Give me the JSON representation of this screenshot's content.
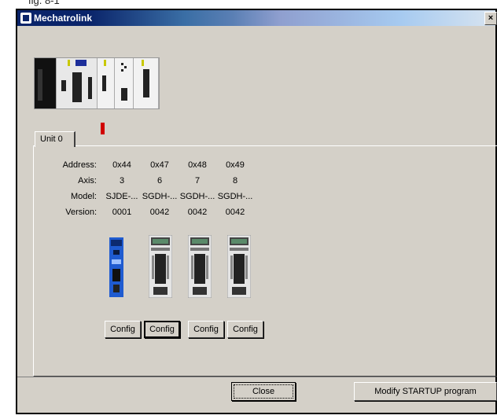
{
  "caption": "fig. 8-1",
  "window": {
    "title": "Mechatrolink",
    "close_glyph": "×"
  },
  "tab": {
    "label": "Unit 0"
  },
  "row_labels": {
    "address": "Address:",
    "axis": "Axis:",
    "model": "Model:",
    "version": "Version:"
  },
  "devices": [
    {
      "address": "0x44",
      "axis": "3",
      "model": "SJDE-...",
      "version": "0001",
      "config_label": "Config"
    },
    {
      "address": "0x47",
      "axis": "6",
      "model": "SGDH-...",
      "version": "0042",
      "config_label": "Config"
    },
    {
      "address": "0x48",
      "axis": "7",
      "model": "SGDH-...",
      "version": "0042",
      "config_label": "Config"
    },
    {
      "address": "0x49",
      "axis": "8",
      "model": "SGDH-...",
      "version": "0042",
      "config_label": "Config"
    }
  ],
  "buttons": {
    "close": "Close",
    "modify": "Modify STARTUP program"
  },
  "colors": {
    "title_dark": "#0a246a",
    "face": "#d4d0c8",
    "marker": "#d00000",
    "drive_blue": "#1f5bd0"
  }
}
